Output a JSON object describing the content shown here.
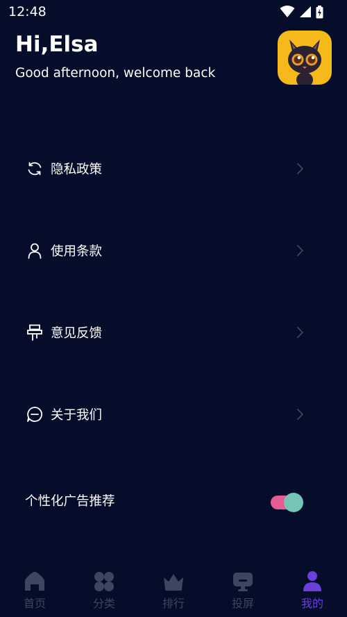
{
  "status_bar": {
    "time": "12:48"
  },
  "header": {
    "greeting": "Hi,Elsa",
    "subtitle": "Good afternoon, welcome back"
  },
  "menu": [
    {
      "label": "隐私政策",
      "icon": "refresh-icon"
    },
    {
      "label": "使用条款",
      "icon": "user-icon"
    },
    {
      "label": "意见反馈",
      "icon": "feedback-icon"
    },
    {
      "label": "关于我们",
      "icon": "chat-icon"
    }
  ],
  "ads_setting": {
    "label": "个性化广告推荐",
    "enabled": true
  },
  "tabs": [
    {
      "label": "首页",
      "icon": "home-icon"
    },
    {
      "label": "分类",
      "icon": "category-icon"
    },
    {
      "label": "排行",
      "icon": "crown-icon"
    },
    {
      "label": "投屏",
      "icon": "tv-icon"
    },
    {
      "label": "我的",
      "icon": "profile-icon",
      "active": true
    }
  ],
  "colors": {
    "background": "#050d2a",
    "tab_inactive": "#3d4560",
    "tab_active": "#6a3fdc",
    "toggle_track": "#e35d92",
    "toggle_thumb": "#74c5b7",
    "avatar_bg": "#f5b91c"
  }
}
